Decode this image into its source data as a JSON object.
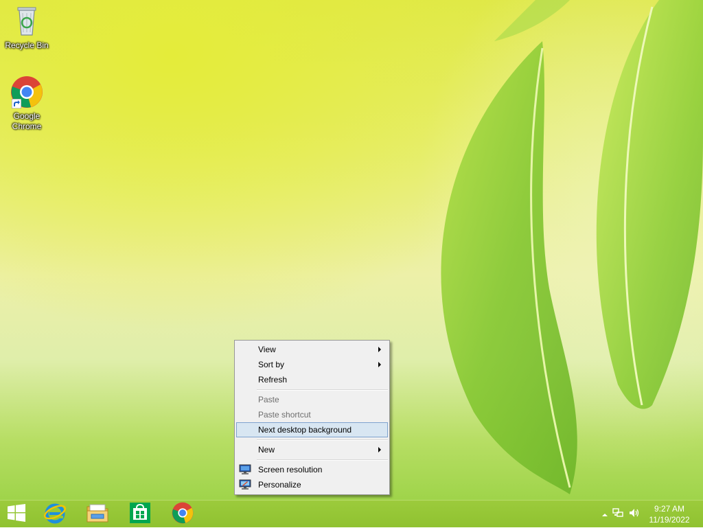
{
  "desktop": {
    "icons": [
      {
        "label": "Recycle Bin",
        "icon": "recycle-bin-icon"
      },
      {
        "label": "Google Chrome",
        "icon": "chrome-icon"
      }
    ]
  },
  "context_menu": {
    "items": {
      "view": {
        "label": "View",
        "submenu": true
      },
      "sort_by": {
        "label": "Sort by",
        "submenu": true
      },
      "refresh": {
        "label": "Refresh"
      },
      "paste": {
        "label": "Paste",
        "disabled": true
      },
      "paste_shortcut": {
        "label": "Paste shortcut",
        "disabled": true
      },
      "next_background": {
        "label": "Next desktop background",
        "highlighted": true
      },
      "new": {
        "label": "New",
        "submenu": true
      },
      "screen_resolution": {
        "label": "Screen resolution",
        "icon": "monitor-icon"
      },
      "personalize": {
        "label": "Personalize",
        "icon": "personalize-icon"
      }
    }
  },
  "taskbar": {
    "pinned": [
      "start-button",
      "internet-explorer-icon",
      "file-explorer-icon",
      "store-icon",
      "chrome-icon"
    ],
    "tray_icons": [
      "show-hidden-icons",
      "network-icon",
      "volume-icon"
    ],
    "clock": {
      "time": "9:27 AM",
      "date": "11/19/2022"
    },
    "color": "#95c636"
  },
  "colors": {
    "menu_background": "#f0f0f0",
    "menu_highlight": "#d8e6f2",
    "menu_highlight_border": "#7da2ce",
    "disabled_text": "#6d6d6d"
  }
}
